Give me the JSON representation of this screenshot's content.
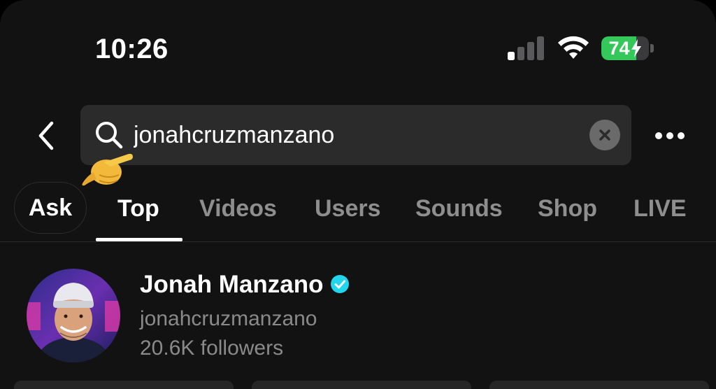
{
  "status_bar": {
    "time": "10:26",
    "battery_level": "74",
    "battery_fraction": 0.74,
    "signal_bars_active": 1,
    "signal_bars_total": 4,
    "charging": true
  },
  "header": {
    "back_icon": "chevron-left-icon",
    "search_icon": "search-icon",
    "search_value": "jonahcruzmanzano",
    "clear_icon": "clear-icon",
    "more_icon": "more-icon",
    "annotation_emoji": "pointing-hand-icon"
  },
  "tabs": {
    "ask_label": "Ask",
    "items": [
      {
        "label": "Top",
        "active": true
      },
      {
        "label": "Videos",
        "active": false
      },
      {
        "label": "Users",
        "active": false
      },
      {
        "label": "Sounds",
        "active": false
      },
      {
        "label": "Shop",
        "active": false
      },
      {
        "label": "LIVE",
        "active": false
      }
    ]
  },
  "user_result": {
    "name": "Jonah Manzano",
    "verified": true,
    "handle": "jonahcruzmanzano",
    "followers": "20.6K followers"
  },
  "colors": {
    "background": "#121212",
    "accent_battery": "#34c759",
    "verified": "#20d5ec",
    "muted_text": "#8a8a8a"
  }
}
